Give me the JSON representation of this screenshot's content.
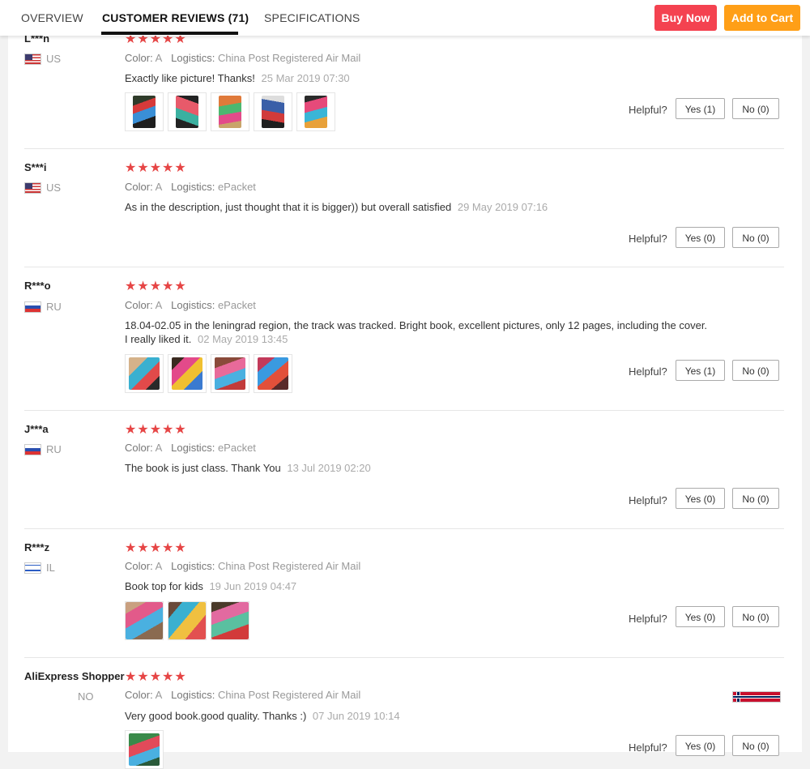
{
  "tabs": {
    "overview": "OVERVIEW",
    "reviews": "CUSTOMER REVIEWS (71)",
    "specifications": "SPECIFICATIONS"
  },
  "actions": {
    "buy_now": "Buy Now",
    "add_to_cart": "Add to Cart"
  },
  "labels": {
    "color": "Color:",
    "logistics": "Logistics:",
    "helpful": "Helpful?"
  },
  "colors": {
    "buy_now": "#f44250",
    "add_to_cart": "#ff9f17",
    "stars": "#e64545"
  },
  "reviews": [
    {
      "user": "L***n",
      "country": "US",
      "flag_icon": "us-flag-icon",
      "stars": "★★★★★",
      "rating": 5,
      "color": "A",
      "logistics": "China Post Registered Air Mail",
      "text": "Exactly like picture! Thanks!",
      "date": "25 Mar 2019 07:30",
      "yes": "Yes (1)",
      "no": "No (0)",
      "photo_count": 5
    },
    {
      "user": "S***i",
      "country": "US",
      "flag_icon": "us-flag-icon",
      "stars": "★★★★★",
      "rating": 5,
      "color": "A",
      "logistics": "ePacket",
      "text": "As in the description, just thought that it is bigger)) but overall satisfied",
      "date": "29 May 2019 07:16",
      "yes": "Yes (0)",
      "no": "No (0)",
      "photo_count": 0
    },
    {
      "user": "R***o",
      "country": "RU",
      "flag_icon": "ru-flag-icon",
      "stars": "★★★★★",
      "rating": 5,
      "color": "A",
      "logistics": "ePacket",
      "text": "18.04-02.05 in the leningrad region, the track was tracked. Bright book, excellent pictures, only 12 pages, including the cover. I really liked it.",
      "date": "02 May 2019 13:45",
      "yes": "Yes (1)",
      "no": "No (0)",
      "photo_count": 4
    },
    {
      "user": "J***a",
      "country": "RU",
      "flag_icon": "ru-flag-icon",
      "stars": "★★★★★",
      "rating": 5,
      "color": "A",
      "logistics": "ePacket",
      "text": "The book is just class. Thank You",
      "date": "13 Jul 2019 02:20",
      "yes": "Yes (0)",
      "no": "No (0)",
      "photo_count": 0
    },
    {
      "user": "R***z",
      "country": "IL",
      "flag_icon": "il-flag-icon",
      "stars": "★★★★★",
      "rating": 5,
      "color": "A",
      "logistics": "China Post Registered Air Mail",
      "text": "Book top for kids",
      "date": "19 Jun 2019 04:47",
      "yes": "Yes (0)",
      "no": "No (0)",
      "photo_count": 3
    },
    {
      "user": "AliExpress Shopper",
      "country": "NO",
      "flag_icon": "no-flag-icon",
      "stars": "★★★★★",
      "rating": 5,
      "color": "A",
      "logistics": "China Post Registered Air Mail",
      "text": "Very good book.good quality. Thanks :)",
      "date": "07 Jun 2019 10:14",
      "yes": "Yes (0)",
      "no": "No (0)",
      "photo_count": 1
    }
  ]
}
